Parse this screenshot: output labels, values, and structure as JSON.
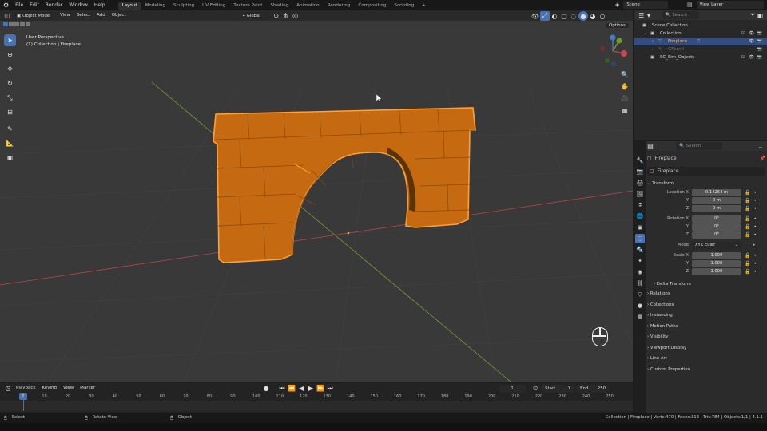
{
  "menu": [
    "File",
    "Edit",
    "Render",
    "Window",
    "Help"
  ],
  "workspaces": [
    "Layout",
    "Modeling",
    "Sculpting",
    "UV Editing",
    "Texture Paint",
    "Shading",
    "Animation",
    "Rendering",
    "Compositing",
    "Scripting"
  ],
  "active_workspace": "Layout",
  "scene_label": "Scene",
  "view_layer_label": "View Layer",
  "viewport": {
    "mode": "Object Mode",
    "menus": [
      "View",
      "Select",
      "Add",
      "Object"
    ],
    "orientation": "Global",
    "perspective": "User Perspective",
    "context": "(1) Collection | Fireplace",
    "options": "Options"
  },
  "outliner": {
    "search_placeholder": "Search",
    "rows": [
      "Scene Collection",
      "Collection",
      "Fireplace",
      "GPencil",
      "SC_Sim_Objects"
    ]
  },
  "properties": {
    "search_placeholder": "Search",
    "object_name": "Fireplace",
    "datablock_name": "Fireplace",
    "transform_label": "Transform",
    "location_x_label": "Location X",
    "location": [
      "0.14264 m",
      "0 m",
      "0 m"
    ],
    "rotation_x_label": "Rotation X",
    "rotation": [
      "0°",
      "0°",
      "0°"
    ],
    "axis_y": "Y",
    "axis_z": "Z",
    "mode_label": "Mode",
    "mode_value": "XYZ Euler",
    "scale_x_label": "Scale X",
    "scale": [
      "1.000",
      "1.000",
      "1.000"
    ],
    "delta_transform": "Delta Transform",
    "panels": [
      "Relations",
      "Collections",
      "Instancing",
      "Motion Paths",
      "Visibility",
      "Viewport Display",
      "Line Art",
      "Custom Properties"
    ]
  },
  "timeline": {
    "menus": [
      "Playback",
      "Keying",
      "View",
      "Marker"
    ],
    "current_frame": "1",
    "start_label": "Start",
    "start": "1",
    "end_label": "End",
    "end": "250",
    "ticks": [
      "1",
      "10",
      "20",
      "30",
      "40",
      "50",
      "60",
      "70",
      "80",
      "90",
      "100",
      "110",
      "120",
      "130",
      "140",
      "150",
      "160",
      "170",
      "180",
      "190",
      "200",
      "210",
      "220",
      "230",
      "240",
      "250"
    ]
  },
  "status": {
    "select": "Select",
    "rotate_view": "Rotate View",
    "object": "Object",
    "stats": "Collection | Fireplace | Verts:470 | Faces:313 | Tris:784 | Objects:1/1 | 4.1.1"
  },
  "colors": {
    "accent": "#4772b3",
    "selection_outline": "#ffa033",
    "object_orange": "#c56a10",
    "x_axis": "#b5474a",
    "y_axis": "#7a9b32"
  }
}
